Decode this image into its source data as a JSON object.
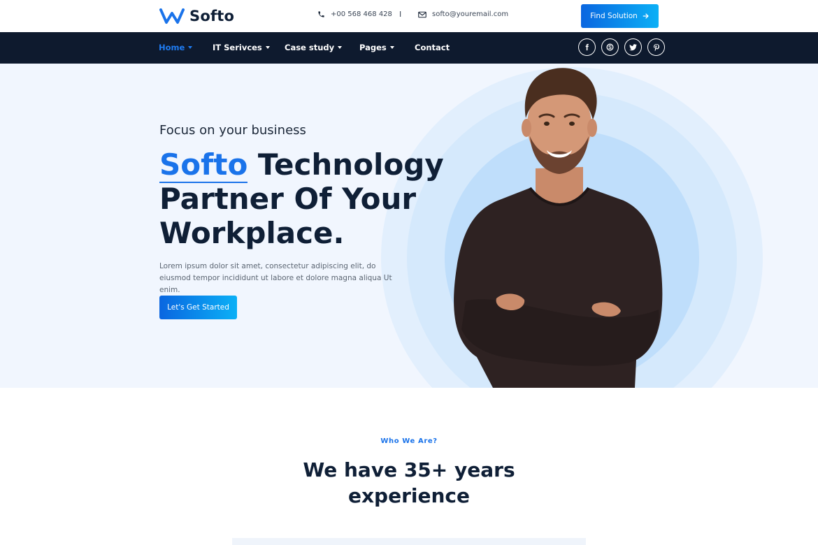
{
  "brand": {
    "name": "Softo",
    "accent": "#1a73ea",
    "dark": "#0f1f36"
  },
  "topbar": {
    "phone_icon": "phone-icon",
    "phone": "+00 568 468 428",
    "separator": "I",
    "email_icon": "envelope-icon",
    "email": "softo@youremail.com",
    "find_button": "Find Solution",
    "find_button_icon": "arrow-right-icon"
  },
  "nav": {
    "items": [
      {
        "label": "Home",
        "active": true,
        "dropdown": true
      },
      {
        "label": "IT Serivces",
        "active": false,
        "dropdown": true
      },
      {
        "label": "Case study",
        "active": false,
        "dropdown": true
      },
      {
        "label": "Pages",
        "active": false,
        "dropdown": true
      },
      {
        "label": "Contact",
        "active": false,
        "dropdown": false
      }
    ],
    "socials": [
      "facebook-icon",
      "skype-icon",
      "twitter-icon",
      "pinterest-icon"
    ]
  },
  "hero": {
    "subtitle": "Focus on your business",
    "title_accent": "Softo",
    "title_rest_line1": " Technology",
    "title_line2": "Partner Of Your",
    "title_line3": "Workplace.",
    "description": "Lorem ipsum dolor sit amet, consectetur adipiscing elit, do eiusmod tempor incididunt ut labore et dolore magna aliqua Ut enim.",
    "cta": "Let's Get Started"
  },
  "about": {
    "eyebrow": "Who We Are?",
    "heading_line1": "We have 35+ years",
    "heading_line2": "experience"
  }
}
